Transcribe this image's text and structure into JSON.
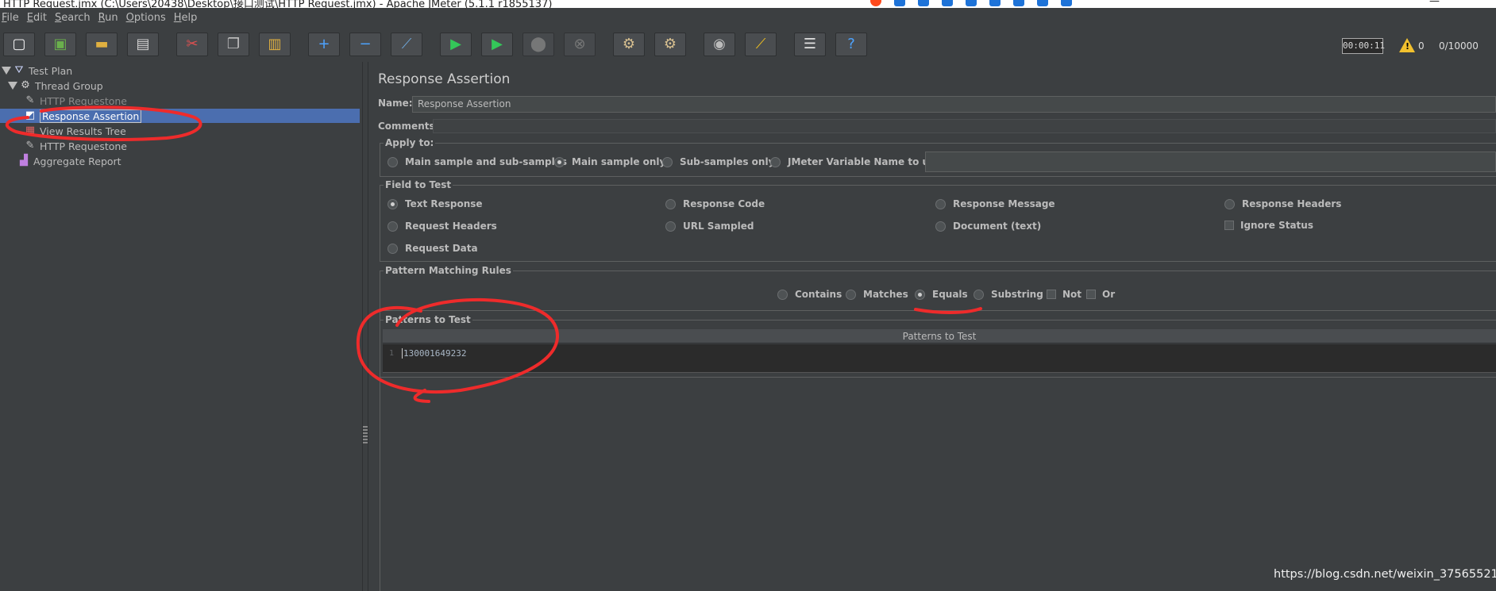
{
  "window": {
    "title": "HTTP Request.jmx (C:\\Users\\20438\\Desktop\\接口测试\\HTTP Request.jmx) - Apache JMeter (5.1.1 r1855137)"
  },
  "menu": [
    {
      "label": "File",
      "underline": "F",
      "rest": "ile"
    },
    {
      "label": "Edit",
      "underline": "E",
      "rest": "dit"
    },
    {
      "label": "Search",
      "underline": "S",
      "rest": "earch"
    },
    {
      "label": "Run",
      "underline": "R",
      "rest": "un"
    },
    {
      "label": "Options",
      "underline": "O",
      "rest": "ptions"
    },
    {
      "label": "Help",
      "underline": "H",
      "rest": "elp"
    }
  ],
  "toolbar": {
    "buttons": [
      {
        "name": "new-icon",
        "glyph": "▢",
        "color": "#f0f0f0"
      },
      {
        "name": "templates-icon",
        "glyph": "▣",
        "color": "#6ab04c"
      },
      {
        "name": "open-icon",
        "glyph": "▬",
        "color": "#e0b040"
      },
      {
        "name": "save-icon",
        "glyph": "▤",
        "color": "#d0d0d0"
      },
      {
        "name": "cut-icon",
        "glyph": "✂",
        "color": "#e05050"
      },
      {
        "name": "copy-icon",
        "glyph": "❐",
        "color": "#c0c0c0"
      },
      {
        "name": "paste-icon",
        "glyph": "▥",
        "color": "#e0b040"
      },
      {
        "name": "expand-icon",
        "glyph": "+",
        "color": "#4da3ff"
      },
      {
        "name": "collapse-icon",
        "glyph": "−",
        "color": "#4da3ff"
      },
      {
        "name": "toggle-icon",
        "glyph": "⟋",
        "color": "#6fa8dc"
      },
      {
        "name": "start-icon",
        "glyph": "▶",
        "color": "#34c759"
      },
      {
        "name": "start-no-pauses-icon",
        "glyph": "▶",
        "color": "#34c759"
      },
      {
        "name": "stop-icon",
        "glyph": "⬤",
        "color": "#8a8a8a"
      },
      {
        "name": "shutdown-icon",
        "glyph": "⊗",
        "color": "#8a8a8a"
      },
      {
        "name": "clear-icon",
        "glyph": "⚙",
        "color": "#d8c090"
      },
      {
        "name": "clear-all-icon",
        "glyph": "⚙",
        "color": "#d8c090"
      },
      {
        "name": "search-icon",
        "glyph": "◉",
        "color": "#bbbbbb"
      },
      {
        "name": "reset-search-icon",
        "glyph": "⟋",
        "color": "#f0c020"
      },
      {
        "name": "function-helper-icon",
        "glyph": "☰",
        "color": "#e0e0e0"
      },
      {
        "name": "help-icon",
        "glyph": "?",
        "color": "#4da3ff"
      }
    ],
    "timer": "00:00:11",
    "warning_count": "0",
    "threads": "0/10000"
  },
  "tree": {
    "items": [
      {
        "label": "Test Plan",
        "icon": "test-plan-icon"
      },
      {
        "label": "Thread Group",
        "icon": "thread-group-icon"
      },
      {
        "label": "HTTP Requestone",
        "icon": "http-request-icon"
      },
      {
        "label": "Response Assertion",
        "icon": "response-assertion-icon"
      },
      {
        "label": "View Results Tree",
        "icon": "view-results-tree-icon"
      },
      {
        "label": "HTTP Requestone",
        "icon": "http-request-icon"
      },
      {
        "label": "Aggregate Report",
        "icon": "aggregate-report-icon"
      }
    ]
  },
  "editor": {
    "title": "Response Assertion",
    "name_label": "Name:",
    "name_value": "Response Assertion",
    "comments_label": "Comments:",
    "apply_to": {
      "legend": "Apply to:",
      "options": [
        "Main sample and sub-samples",
        "Main sample only",
        "Sub-samples only",
        "JMeter Variable Name to use"
      ],
      "selected": "Main sample only"
    },
    "field_to_test": {
      "legend": "Field to Test",
      "options": [
        "Text Response",
        "Response Code",
        "Response Message",
        "Response Headers",
        "Request Headers",
        "URL Sampled",
        "Document (text)",
        "Request Data"
      ],
      "ignore_status_label": "Ignore Status",
      "selected": "Text Response"
    },
    "pattern_matching": {
      "legend": "Pattern Matching Rules",
      "options": [
        "Contains",
        "Matches",
        "Equals",
        "Substring"
      ],
      "checks": [
        "Not",
        "Or"
      ],
      "selected": "Equals"
    },
    "patterns": {
      "legend": "Patterns to Test",
      "column_header": "Patterns to Test",
      "line_number": "1",
      "value": "130001649232"
    }
  },
  "watermark": "https://blog.csdn.net/weixin_37565521"
}
